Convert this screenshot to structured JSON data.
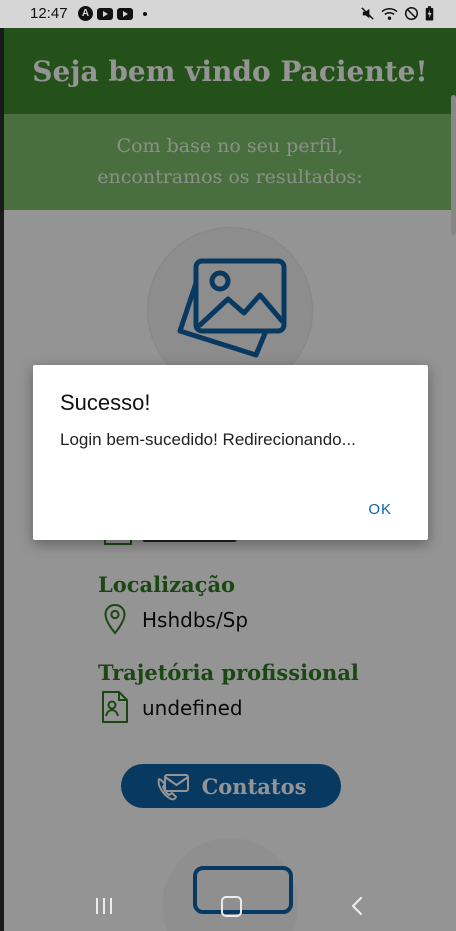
{
  "status_bar": {
    "time": "12:47",
    "left_badge": "A"
  },
  "header": {
    "title": "Seja bem vindo Paciente!"
  },
  "subheader": {
    "line1": "Com base no seu perfil,",
    "line2": "encontramos os resultados:"
  },
  "profile": {
    "location_title": "Localização",
    "location_value": "Hshdbs/Sp",
    "career_title": "Trajetória profissional",
    "career_value": "undefined",
    "contacts_button": "Contatos"
  },
  "dialog": {
    "title": "Sucesso!",
    "message": "Login bem-sucedido! Redirecionando...",
    "ok_label": "OK"
  },
  "colors": {
    "header_green": "#3e8a2c",
    "subheader_green": "#7fc06d",
    "accent_blue": "#0e63a8"
  }
}
